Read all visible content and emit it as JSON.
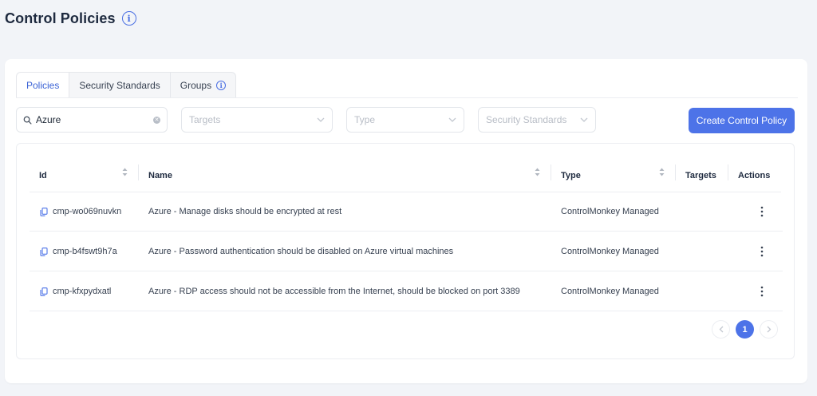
{
  "header": {
    "title": "Control Policies"
  },
  "tabs": [
    {
      "label": "Policies",
      "active": true
    },
    {
      "label": "Security Standards",
      "active": false
    },
    {
      "label": "Groups",
      "active": false,
      "has_info": true
    }
  ],
  "filters": {
    "search_value": "Azure",
    "targets_placeholder": "Targets",
    "type_placeholder": "Type",
    "security_standards_placeholder": "Security Standards"
  },
  "create_button_label": "Create Control Policy",
  "table": {
    "columns": [
      "Id",
      "Name",
      "Type",
      "Targets",
      "Actions"
    ],
    "rows": [
      {
        "id": "cmp-wo069nuvkn",
        "name": "Azure - Manage disks should be encrypted at rest",
        "type": "ControlMonkey Managed",
        "targets": ""
      },
      {
        "id": "cmp-b4fswt9h7a",
        "name": "Azure - Password authentication should be disabled on Azure virtual machines",
        "type": "ControlMonkey Managed",
        "targets": ""
      },
      {
        "id": "cmp-kfxpydxatl",
        "name": "Azure - RDP access should not be accessible from the Internet, should be blocked on port 3389",
        "type": "ControlMonkey Managed",
        "targets": ""
      }
    ]
  },
  "pagination": {
    "current_page": "1"
  },
  "icons": {
    "title_info": "info-icon",
    "search": "search-icon",
    "clear": "clear-icon",
    "dropdown": "chevron-down-icon",
    "copy": "copy-icon",
    "sort": "sort-icon",
    "actions": "kebab-menu-icon",
    "prev": "chevron-left-icon",
    "next": "chevron-right-icon"
  },
  "colors": {
    "accent": "#4d73e8",
    "page_bg": "#f2f4f8",
    "card_bg": "#ffffff"
  }
}
